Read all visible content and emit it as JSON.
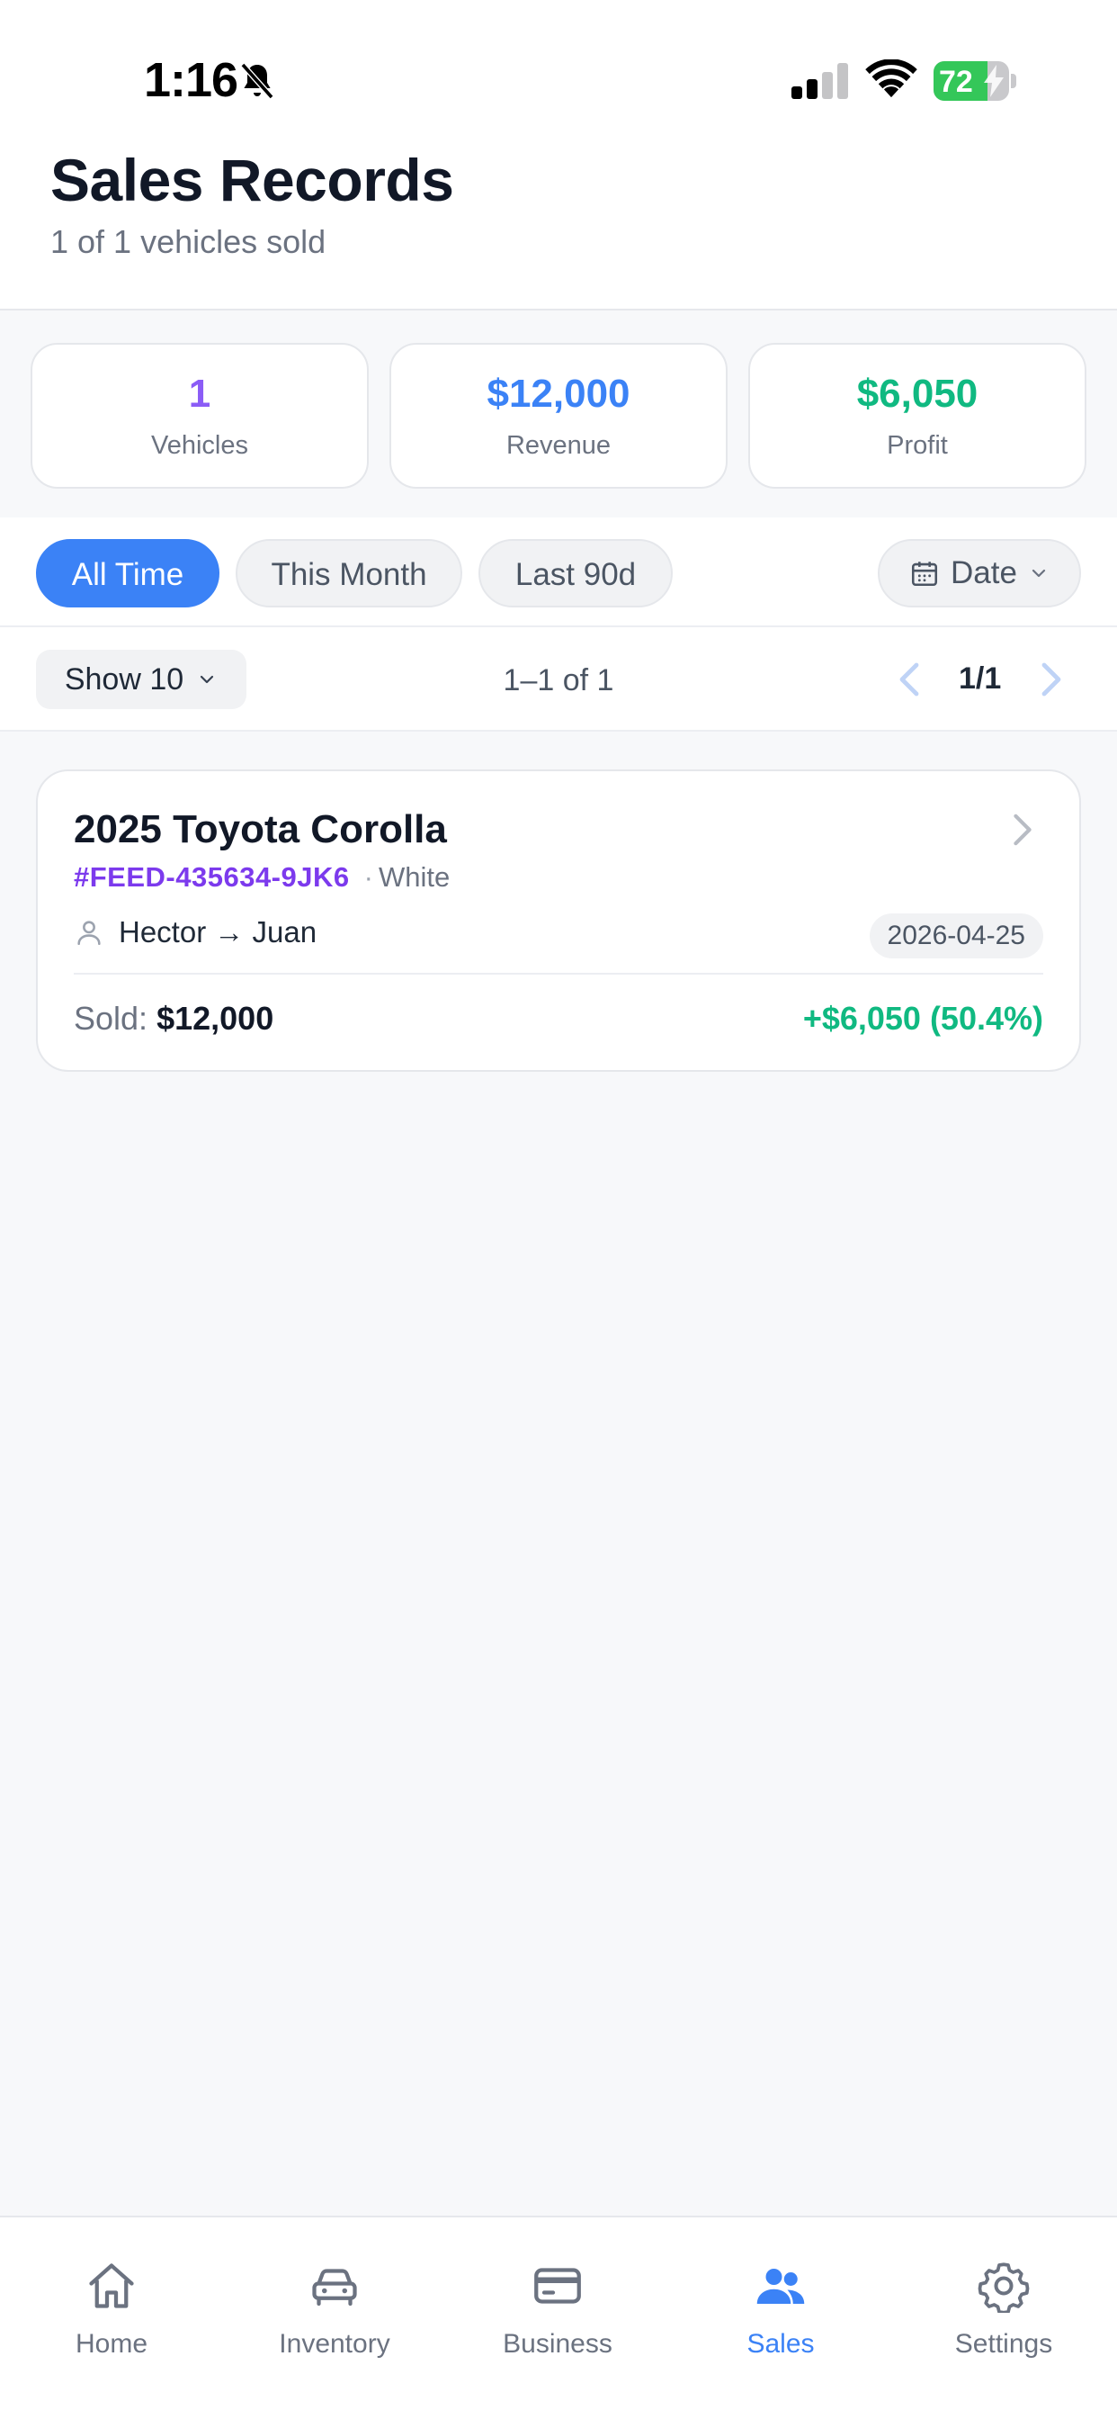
{
  "status_bar": {
    "time": "1:16",
    "battery_level": "72",
    "battery_fraction": 0.72
  },
  "header": {
    "title": "Sales Records",
    "subtitle": "1 of 1 vehicles sold"
  },
  "stats": [
    {
      "value": "1",
      "label": "Vehicles",
      "color": "#8b5cf6"
    },
    {
      "value": "$12,000",
      "label": "Revenue",
      "color": "#3b82f6"
    },
    {
      "value": "$6,050",
      "label": "Profit",
      "color": "#10b981"
    }
  ],
  "filters": {
    "chips": [
      {
        "label": "All Time",
        "active": true
      },
      {
        "label": "This Month",
        "active": false
      },
      {
        "label": "Last 90d",
        "active": false
      }
    ],
    "sort_label": "Date"
  },
  "pagination": {
    "page_size_label": "Show 10",
    "range": "1–1 of 1",
    "page": "1/1"
  },
  "sales": [
    {
      "title": "2025 Toyota Corolla",
      "vin": "#FEED-435634-9JK6",
      "separator": "·",
      "color": "White",
      "parties": "Hector → Juan",
      "date": "2026-04-25",
      "sold_label": "Sold:",
      "sold_value": "$12,000",
      "profit": "+$6,050 (50.4%)"
    }
  ],
  "tabs": [
    {
      "label": "Home",
      "icon": "home-icon",
      "active": false
    },
    {
      "label": "Inventory",
      "icon": "car-icon",
      "active": false
    },
    {
      "label": "Business",
      "icon": "card-icon",
      "active": false
    },
    {
      "label": "Sales",
      "icon": "users-icon",
      "active": true
    },
    {
      "label": "Settings",
      "icon": "gear-icon",
      "active": false
    }
  ],
  "colors": {
    "accent": "#3b82f6",
    "purple": "#7c3aed",
    "green": "#10b981"
  }
}
